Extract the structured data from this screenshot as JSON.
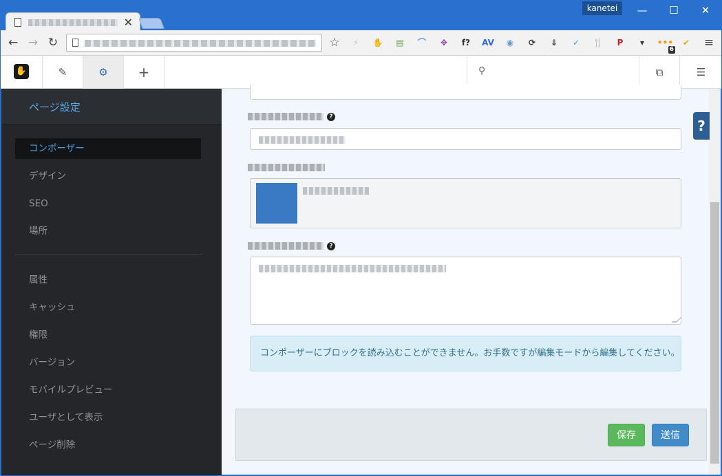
{
  "window": {
    "user": "kanetei",
    "minimize": "—",
    "maximize": "☐",
    "close": "✕",
    "tab_close": "✕"
  },
  "browser": {
    "back": "←",
    "forward": "→",
    "reload": "↻",
    "bookmark": "☆",
    "menu": "≡",
    "extensions": [
      {
        "icon": "lightning-icon",
        "glyph": "⚡",
        "color": "#c8c8c8"
      },
      {
        "icon": "concrete5-hand-icon",
        "glyph": "✋",
        "color": "#222222"
      },
      {
        "icon": "sheet-icon",
        "glyph": "▤",
        "color": "#6aa84f"
      },
      {
        "icon": "swoosh-icon",
        "glyph": "⌒",
        "color": "#5b8fd8"
      },
      {
        "icon": "crosshair-icon",
        "glyph": "✥",
        "color": "#8e44ad"
      },
      {
        "icon": "font-question-icon",
        "glyph": "f?",
        "color": "#333333"
      },
      {
        "icon": "av-icon",
        "glyph": "AV",
        "color": "#2f6fd8"
      },
      {
        "icon": "camera-icon",
        "glyph": "◉",
        "color": "#6b9ac7"
      },
      {
        "icon": "refresh-icon",
        "glyph": "⟳",
        "color": "#333333"
      },
      {
        "icon": "download-icon",
        "glyph": "⇓",
        "color": "#333333"
      },
      {
        "icon": "check-box-icon",
        "glyph": "✓",
        "color": "#29a8e0"
      },
      {
        "icon": "fork-knife-icon",
        "glyph": "🍴",
        "color": "#f0a020"
      },
      {
        "icon": "pinterest-icon",
        "glyph": "P",
        "color": "#cb2027"
      },
      {
        "icon": "pocket-icon",
        "glyph": "▾",
        "color": "#333333"
      },
      {
        "icon": "rss-icon",
        "glyph": "•••",
        "color": "#f39c12"
      },
      {
        "icon": "norton-check-icon",
        "glyph": "✔",
        "color": "#e0b000"
      }
    ],
    "rss_badge": "6"
  },
  "cms_bar": {
    "edit_icon": "✎",
    "settings_icon": "⚙",
    "add_icon": "+",
    "search_icon": "⚲",
    "pages_icon": "⧉",
    "sliders_icon": "☰"
  },
  "sidebar": {
    "title": "ページ設定",
    "items": [
      {
        "label": "コンポーザー",
        "active": true
      },
      {
        "label": "デザイン"
      },
      {
        "label": "SEO"
      },
      {
        "label": "場所"
      },
      {
        "label": "属性"
      },
      {
        "label": "キャッシュ"
      },
      {
        "label": "権限"
      },
      {
        "label": "バージョン"
      },
      {
        "label": "モバイルプレビュー"
      },
      {
        "label": "ユーザとして表示"
      },
      {
        "label": "ページ削除"
      }
    ]
  },
  "form": {
    "help": "?",
    "alert": "コンポーザーにブロックを読み込むことができません。お手数ですが編集モードから編集してください。"
  },
  "footer": {
    "save": "保存",
    "send": "送信"
  },
  "help_tab": "?"
}
